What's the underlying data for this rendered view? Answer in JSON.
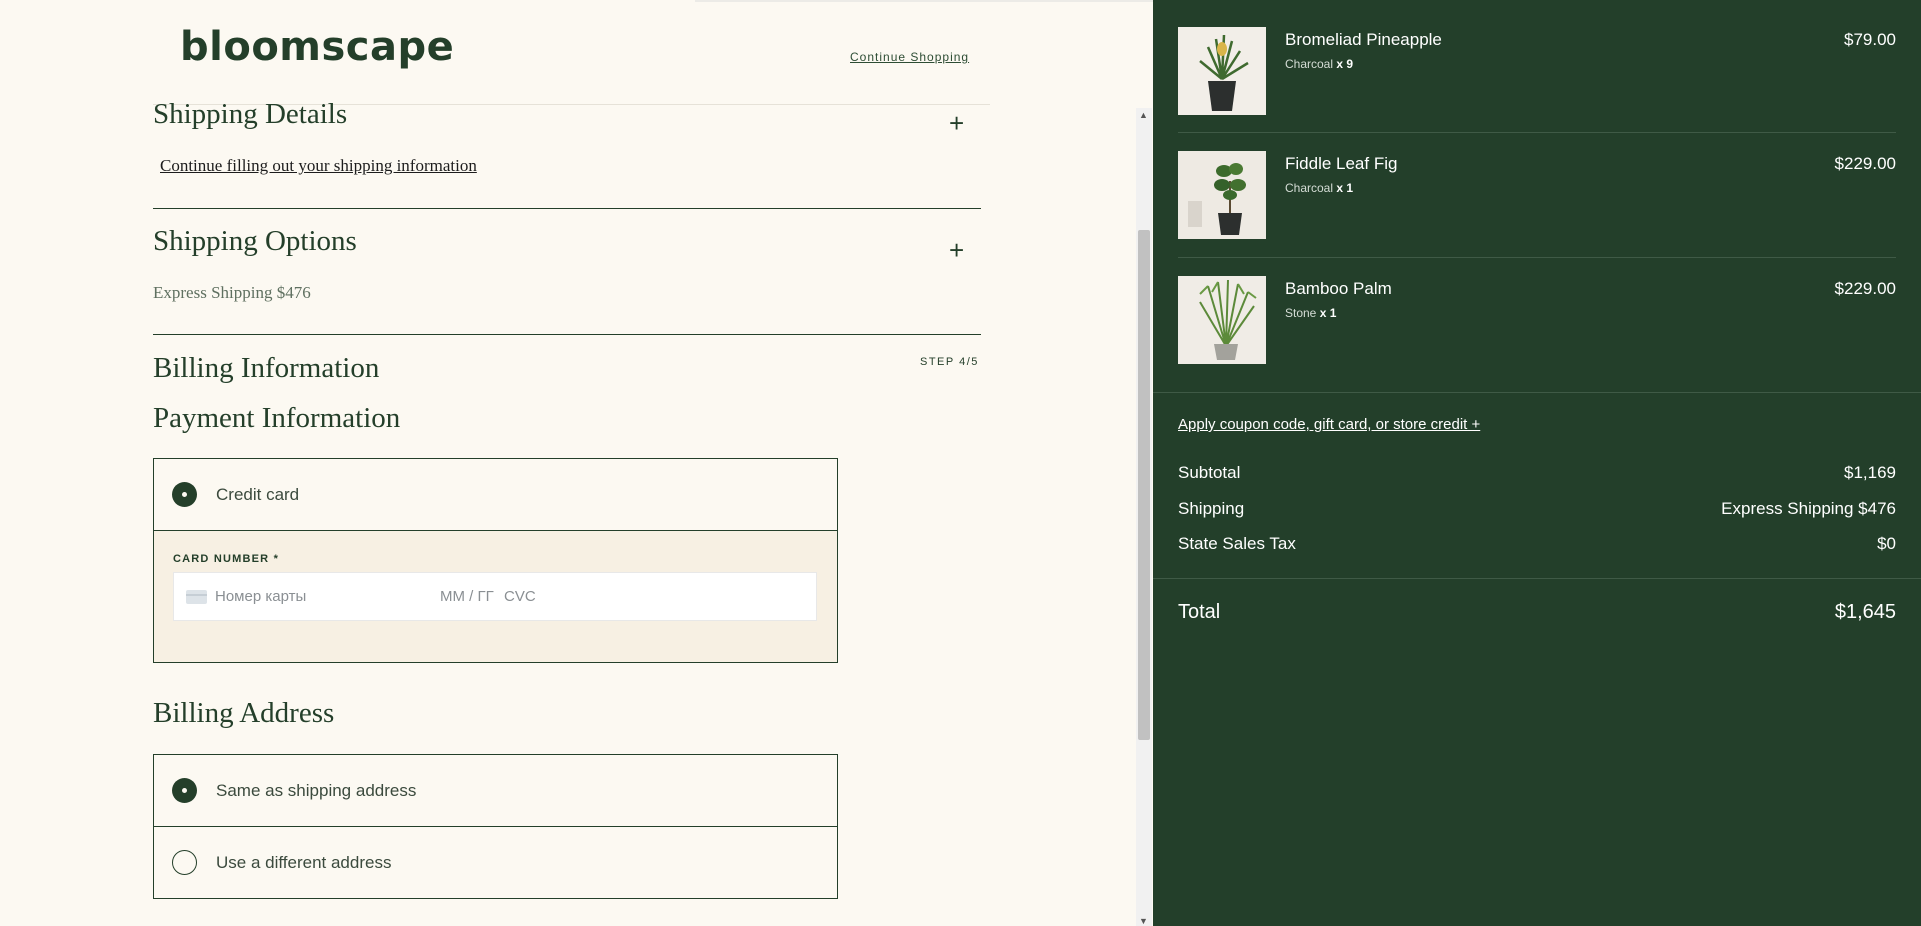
{
  "brand": {
    "logo": "bloomscape"
  },
  "header": {
    "continue_shopping": "Continue Shopping"
  },
  "shipping_details": {
    "title": "Shipping Details",
    "link": "Continue filling out your shipping information"
  },
  "shipping_options": {
    "title": "Shipping Options",
    "selected": "Express Shipping $476"
  },
  "billing": {
    "title": "Billing Information",
    "step": "STEP 4/5"
  },
  "payment": {
    "title": "Payment Information",
    "method_label": "Credit card",
    "card_number_label": "CARD NUMBER *",
    "card_placeholder": "Номер карты",
    "expiry_placeholder": "ММ / ГГ",
    "cvc_placeholder": "CVC"
  },
  "billing_address": {
    "title": "Billing Address",
    "options": [
      {
        "label": "Same as shipping address",
        "selected": true
      },
      {
        "label": "Use a different address",
        "selected": false
      }
    ]
  },
  "cart": {
    "items": [
      {
        "name": "Bromeliad Pineapple",
        "variant": "Charcoal",
        "qty": "x 9",
        "price": "$79.00"
      },
      {
        "name": "Fiddle Leaf Fig",
        "variant": "Charcoal",
        "qty": "x 1",
        "price": "$229.00"
      },
      {
        "name": "Bamboo Palm",
        "variant": "Stone",
        "qty": "x 1",
        "price": "$229.00"
      }
    ],
    "coupon_link": "Apply coupon code, gift card, or store credit +",
    "subtotal_label": "Subtotal",
    "subtotal": "$1,169",
    "shipping_label": "Shipping",
    "shipping": "Express Shipping $476",
    "tax_label": "State Sales Tax",
    "tax": "$0",
    "total_label": "Total",
    "total": "$1,645"
  },
  "colors": {
    "brand_green": "#243f2a",
    "page_bg": "#fcf9f2",
    "card_area_bg": "#f7f0e3"
  }
}
